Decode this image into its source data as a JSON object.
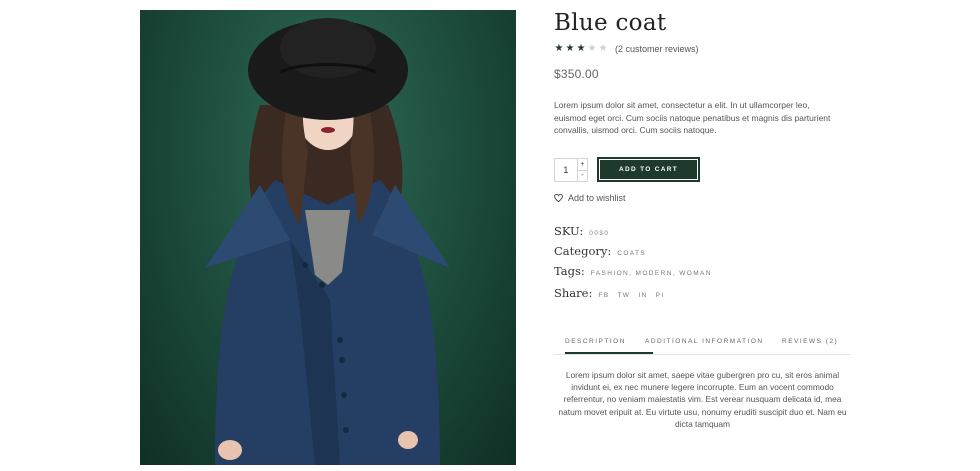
{
  "product": {
    "title": "Blue coat",
    "rating": 3,
    "rating_max": 5,
    "review_link": "(2 customer reviews)",
    "price": "$350.00",
    "description": "Lorem ipsum dolor sit amet, consectetur a elit. In ut ullamcorper leo, euismod eget orci. Cum sociis natoque penatibus et magnis dis parturient convallis, uismod orci. Cum sociis natoque.",
    "quantity": "1",
    "qty_plus": "+",
    "qty_minus": "-",
    "add_to_cart": "ADD TO CART",
    "wishlist": "Add to wishlist"
  },
  "meta": {
    "sku_label": "SKU:",
    "sku_value": "0030",
    "category_label": "Category:",
    "category_value": "COATS",
    "tags_label": "Tags:",
    "tags_value": "FASHION, MODERN, WOMAN",
    "share_label": "Share:",
    "share_links": [
      "FB",
      "TW",
      "IN",
      "PI"
    ]
  },
  "tabs": {
    "items": [
      "DESCRIPTION",
      "ADDITIONAL INFORMATION",
      "REVIEWS (2)"
    ],
    "active": 0,
    "content": "Lorem ipsum dolor sit amet, saepe vitae gubergren pro cu, sit eros animal invidunt ei, ex nec munere legere incorrupte. Eum an vocent commodo referrentur, no veniam maiestatis vim. Est verear nusquam delicata id, mea natum movet eripuit at. Eu virtute usu, nonumy eruditi suscipit duo et. Nam eu dicta tamquam"
  },
  "colors": {
    "accent": "#1e3a2c",
    "image_background": "#1c4a3b",
    "coat": "#243f63"
  }
}
